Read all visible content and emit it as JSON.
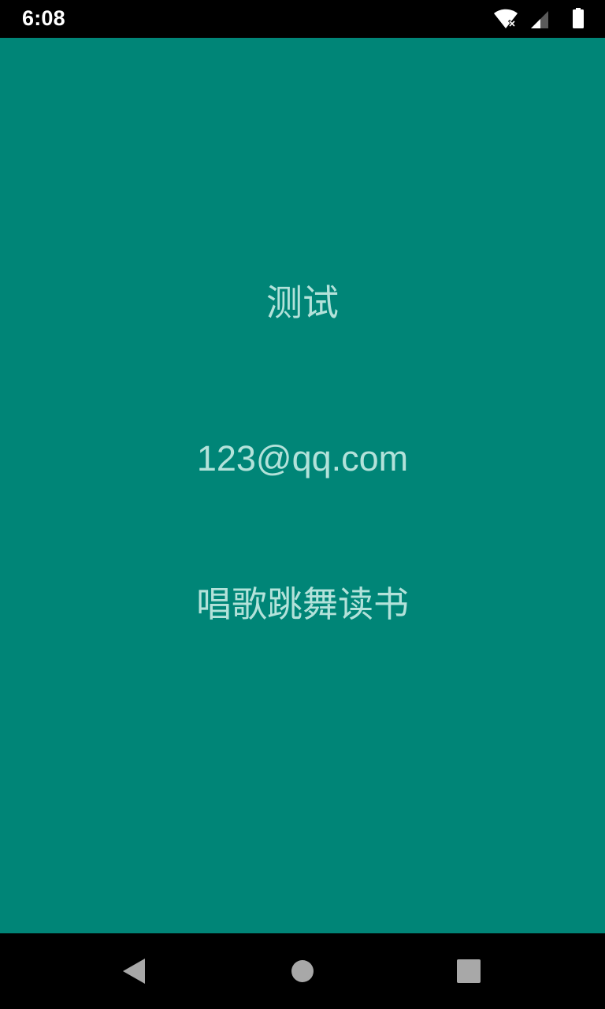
{
  "status_bar": {
    "time": "6:08",
    "icons": [
      "wifi-off-icon",
      "signal-icon",
      "battery-icon"
    ]
  },
  "main": {
    "background_color": "#008577",
    "text_color": "#B3E2DA",
    "lines": {
      "title": "测试",
      "email": "123@qq.com",
      "hobby": "唱歌跳舞读书"
    }
  },
  "nav_bar": {
    "buttons": [
      "back-button",
      "home-button",
      "recents-button"
    ]
  }
}
